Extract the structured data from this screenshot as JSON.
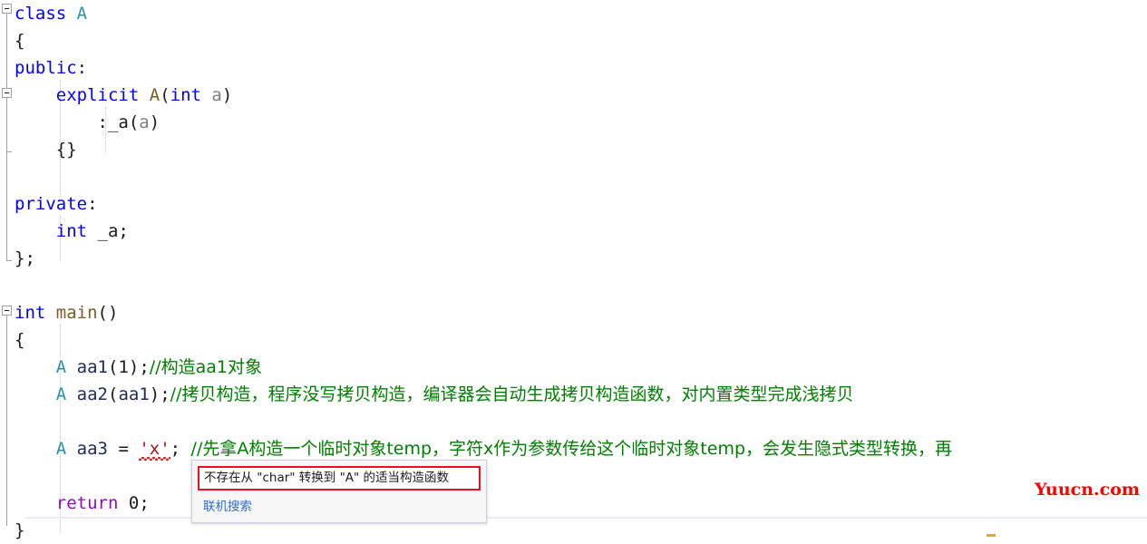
{
  "app": {
    "kind": "visual-studio-cpp-editor",
    "background": "#ffffff"
  },
  "colors": {
    "keyword": "#0000ff",
    "class_type": "#2b91af",
    "function": "#795e26",
    "parameter": "#808080",
    "comment": "#008000",
    "string": "#a31515",
    "control_keyword": "#8f08c4",
    "error_red": "#e81123",
    "link_blue": "#2a6fc9",
    "watermark_red": "#ff0000"
  },
  "code": {
    "lines": [
      {
        "n": 1,
        "fold": "open",
        "tokens": [
          {
            "t": "class",
            "c": "kw"
          },
          {
            "t": " ",
            "c": "pun"
          },
          {
            "t": "A",
            "c": "cls"
          }
        ]
      },
      {
        "n": 2,
        "fold": null,
        "tokens": [
          {
            "t": "{",
            "c": "pun"
          }
        ]
      },
      {
        "n": 3,
        "fold": null,
        "tokens": [
          {
            "t": "public",
            "c": "kw"
          },
          {
            "t": ":",
            "c": "pun"
          }
        ]
      },
      {
        "n": 4,
        "fold": "open",
        "tokens": [
          {
            "t": "    ",
            "c": "pun"
          },
          {
            "t": "explicit",
            "c": "kw"
          },
          {
            "t": " ",
            "c": "pun"
          },
          {
            "t": "A",
            "c": "fn"
          },
          {
            "t": "(",
            "c": "pun"
          },
          {
            "t": "int",
            "c": "kw"
          },
          {
            "t": " ",
            "c": "pun"
          },
          {
            "t": "a",
            "c": "prm"
          },
          {
            "t": ")",
            "c": "pun"
          }
        ]
      },
      {
        "n": 5,
        "fold": null,
        "tokens": [
          {
            "t": "        :_a(",
            "c": "pun"
          },
          {
            "t": "a",
            "c": "prm"
          },
          {
            "t": ")",
            "c": "pun"
          }
        ]
      },
      {
        "n": 6,
        "fold": null,
        "tokens": [
          {
            "t": "    {}",
            "c": "pun"
          }
        ]
      },
      {
        "n": 7,
        "fold": null,
        "tokens": []
      },
      {
        "n": 8,
        "fold": null,
        "tokens": [
          {
            "t": "private",
            "c": "kw"
          },
          {
            "t": ":",
            "c": "pun"
          }
        ]
      },
      {
        "n": 9,
        "fold": null,
        "tokens": [
          {
            "t": "    ",
            "c": "pun"
          },
          {
            "t": "int",
            "c": "kw"
          },
          {
            "t": " _a;",
            "c": "pun"
          }
        ]
      },
      {
        "n": 10,
        "fold": null,
        "tokens": [
          {
            "t": "};",
            "c": "pun"
          }
        ]
      },
      {
        "n": 11,
        "fold": null,
        "tokens": []
      },
      {
        "n": 12,
        "fold": "open",
        "tokens": [
          {
            "t": "int",
            "c": "kw"
          },
          {
            "t": " ",
            "c": "pun"
          },
          {
            "t": "main",
            "c": "fn"
          },
          {
            "t": "()",
            "c": "pun"
          }
        ]
      },
      {
        "n": 13,
        "fold": null,
        "tokens": [
          {
            "t": "{",
            "c": "pun"
          }
        ]
      },
      {
        "n": 14,
        "fold": null,
        "tokens": [
          {
            "t": "    ",
            "c": "pun"
          },
          {
            "t": "A",
            "c": "cls"
          },
          {
            "t": " ",
            "c": "pun"
          },
          {
            "t": "aa1",
            "c": "id"
          },
          {
            "t": "(",
            "c": "pun"
          },
          {
            "t": "1",
            "c": "num"
          },
          {
            "t": ");",
            "c": "pun"
          },
          {
            "t": "//构造aa1对象",
            "c": "cmt"
          }
        ]
      },
      {
        "n": 15,
        "fold": null,
        "tokens": [
          {
            "t": "    ",
            "c": "pun"
          },
          {
            "t": "A",
            "c": "cls"
          },
          {
            "t": " ",
            "c": "pun"
          },
          {
            "t": "aa2",
            "c": "id"
          },
          {
            "t": "(",
            "c": "pun"
          },
          {
            "t": "aa1",
            "c": "id"
          },
          {
            "t": ");",
            "c": "pun"
          },
          {
            "t": "//拷贝构造，程序没写拷贝构造，编译器会自动生成拷贝构造函数，对内置类型完成浅拷贝",
            "c": "cmt"
          }
        ]
      },
      {
        "n": 16,
        "fold": null,
        "tokens": []
      },
      {
        "n": 17,
        "fold": null,
        "tokens": [
          {
            "t": "    ",
            "c": "pun"
          },
          {
            "t": "A",
            "c": "cls"
          },
          {
            "t": " ",
            "c": "pun"
          },
          {
            "t": "aa3",
            "c": "id"
          },
          {
            "t": " = ",
            "c": "pun"
          },
          {
            "t": "'x'",
            "c": "str squiggle"
          },
          {
            "t": "; ",
            "c": "pun"
          },
          {
            "t": "//先拿A构造一个临时对象temp，字符x作为参数传给这个临时对象temp，会发生隐式类型转换，再",
            "c": "cmt"
          }
        ]
      },
      {
        "n": 18,
        "fold": null,
        "tokens": []
      },
      {
        "n": 19,
        "fold": null,
        "tokens": [
          {
            "t": "    ",
            "c": "pun"
          },
          {
            "t": "return",
            "c": "ctl"
          },
          {
            "t": " ",
            "c": "pun"
          },
          {
            "t": "0",
            "c": "num"
          },
          {
            "t": ";",
            "c": "pun"
          }
        ]
      },
      {
        "n": 20,
        "fold": null,
        "tokens": [
          {
            "t": "}",
            "c": "pun"
          }
        ]
      }
    ],
    "plain_text": "class A\n{\npublic:\n    explicit A(int a)\n        :_a(a)\n    {}\n\nprivate:\n    int _a;\n};\n\nint main()\n{\n    A aa1(1);//构造aa1对象\n    A aa2(aa1);//拷贝构造，程序没写拷贝构造，编译器会自动生成拷贝构造函数，对内置类型完成浅拷贝\n\n    A aa3 = 'x'; //先拿A构造一个临时对象temp，字符x作为参数传给这个临时对象temp，会发生隐式类型转换，再\n\n    return 0;\n}"
  },
  "error_popup": {
    "message": "不存在从 \"char\" 转换到 \"A\" 的适当构造函数",
    "link_label": "联机搜索"
  },
  "watermark": {
    "text": "Yuucn.com"
  }
}
